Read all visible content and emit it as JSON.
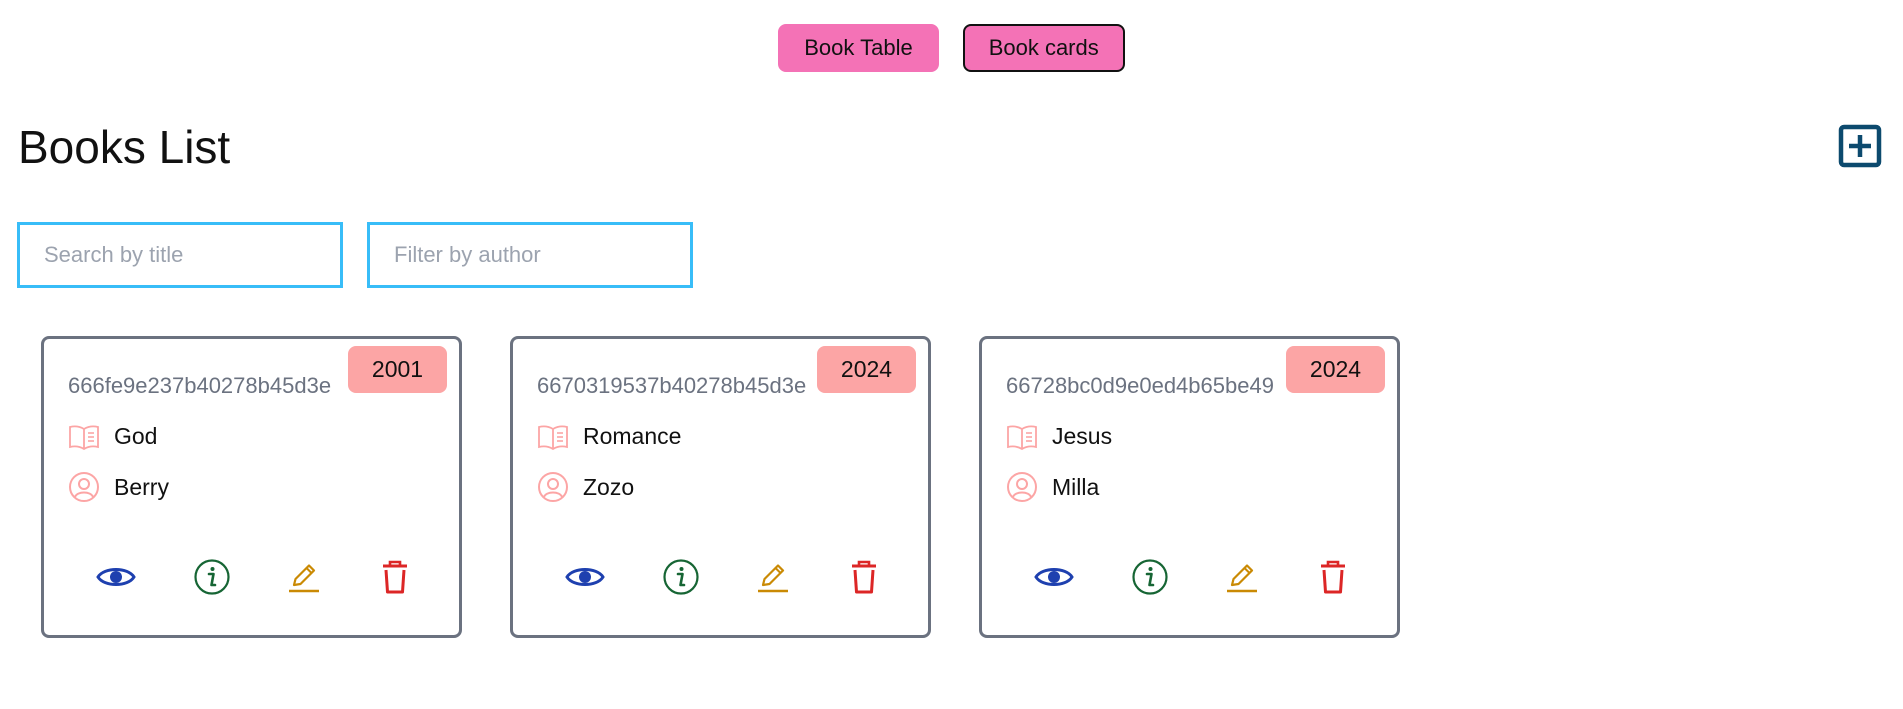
{
  "header": {
    "toggle_table_label": "Book Table",
    "toggle_cards_label": "Book cards"
  },
  "page": {
    "title": "Books List"
  },
  "filters": {
    "title_placeholder": "Search by title",
    "author_placeholder": "Filter by author"
  },
  "colors": {
    "toggle_bg": "#f472b6",
    "input_border": "#38bdf8",
    "badge_bg": "#fca5a5",
    "card_border": "#6b7280",
    "view_icon": "#1e40af",
    "info_icon": "#166534",
    "edit_icon": "#ca8a04",
    "delete_icon": "#dc2626",
    "add_icon": "#0c4a6e"
  },
  "icons": {
    "add": "square-plus-icon",
    "title": "open-book-icon",
    "author": "user-circle-icon",
    "view": "eye-icon",
    "info": "info-circle-icon",
    "edit": "pencil-icon",
    "delete": "trash-icon"
  },
  "books": [
    {
      "id": "666fe9e237b40278b45d3e",
      "year": "2001",
      "title": "God",
      "author": "Berry"
    },
    {
      "id": "6670319537b40278b45d3e",
      "year": "2024",
      "title": "Romance",
      "author": "Zozo"
    },
    {
      "id": "66728bc0d9e0ed4b65be49",
      "year": "2024",
      "title": "Jesus",
      "author": "Milla"
    }
  ]
}
